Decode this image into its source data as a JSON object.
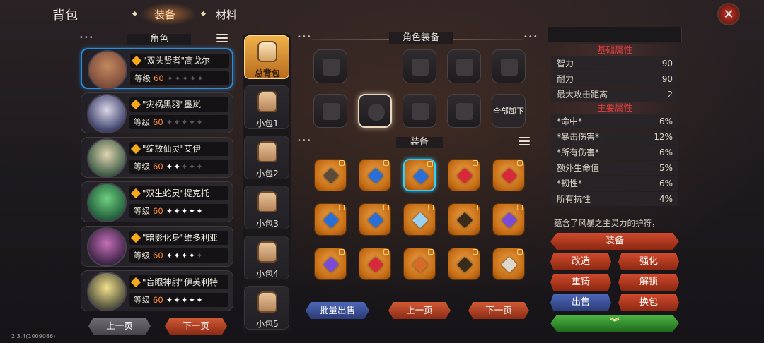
{
  "header": {
    "title": "背包",
    "tabs": [
      {
        "label": "装备",
        "active": true
      },
      {
        "label": "材料",
        "active": false
      }
    ]
  },
  "roles": {
    "title": "角色",
    "heroes": [
      {
        "name": "\"双头贤者\"高戈尔",
        "level_label": "等级",
        "level": "60",
        "stars": 0,
        "selected": true
      },
      {
        "name": "\"灾祸黑羽\"墨岚",
        "level_label": "等级",
        "level": "60",
        "stars": 0,
        "selected": false
      },
      {
        "name": "\"绽放仙灵\"艾伊",
        "level_label": "等级",
        "level": "60",
        "stars": 2,
        "selected": false
      },
      {
        "name": "\"双生蛇灵\"提克托",
        "level_label": "等级",
        "level": "60",
        "stars": 5,
        "selected": false
      },
      {
        "name": "\"暗影化身\"维多利亚",
        "level_label": "等级",
        "level": "60",
        "stars": 4,
        "selected": false
      },
      {
        "name": "\"盲眼神射\"伊芙利特",
        "level_label": "等级",
        "level": "60",
        "stars": 5,
        "selected": false
      }
    ],
    "prev_label": "上一页",
    "next_label": "下一页"
  },
  "bags": [
    {
      "label": "总背包",
      "active": true
    },
    {
      "label": "小包1",
      "active": false
    },
    {
      "label": "小包2",
      "active": false
    },
    {
      "label": "小包3",
      "active": false
    },
    {
      "label": "小包4",
      "active": false
    },
    {
      "label": "小包5",
      "active": false
    }
  ],
  "role_equipment": {
    "title": "角色装备",
    "unequip_all_label": "全部卸下"
  },
  "equipment": {
    "title": "装备",
    "batch_sell_label": "批量出售",
    "prev_label": "上一页",
    "next_label": "下一页"
  },
  "stats": {
    "basic_title": "基础属性",
    "basic": [
      {
        "name": "智力",
        "value": "90"
      },
      {
        "name": "耐力",
        "value": "90"
      },
      {
        "name": "最大攻击距离",
        "value": "2"
      }
    ],
    "main_title": "主要属性",
    "main": [
      {
        "name": "*命中*",
        "value": "6%"
      },
      {
        "name": "*暴击伤害*",
        "value": "12%"
      },
      {
        "name": "*所有伤害*",
        "value": "6%"
      },
      {
        "name": "额外生命值",
        "value": "5%"
      },
      {
        "name": "*韧性*",
        "value": "6%"
      },
      {
        "name": "所有抗性",
        "value": "4%"
      }
    ],
    "description": "蕴含了风暴之主灵力的护符，"
  },
  "actions": {
    "equip": "装备",
    "reform": "改造",
    "enhance": "强化",
    "recast": "重铸",
    "unlock": "解锁",
    "sell": "出售",
    "swap_bag": "换包"
  },
  "version": "2.3.4(1009086)",
  "colors": {
    "accent_orange": "#f0a64a",
    "select_blue": "#2b8cd8",
    "stat_title_red": "#e14040"
  }
}
